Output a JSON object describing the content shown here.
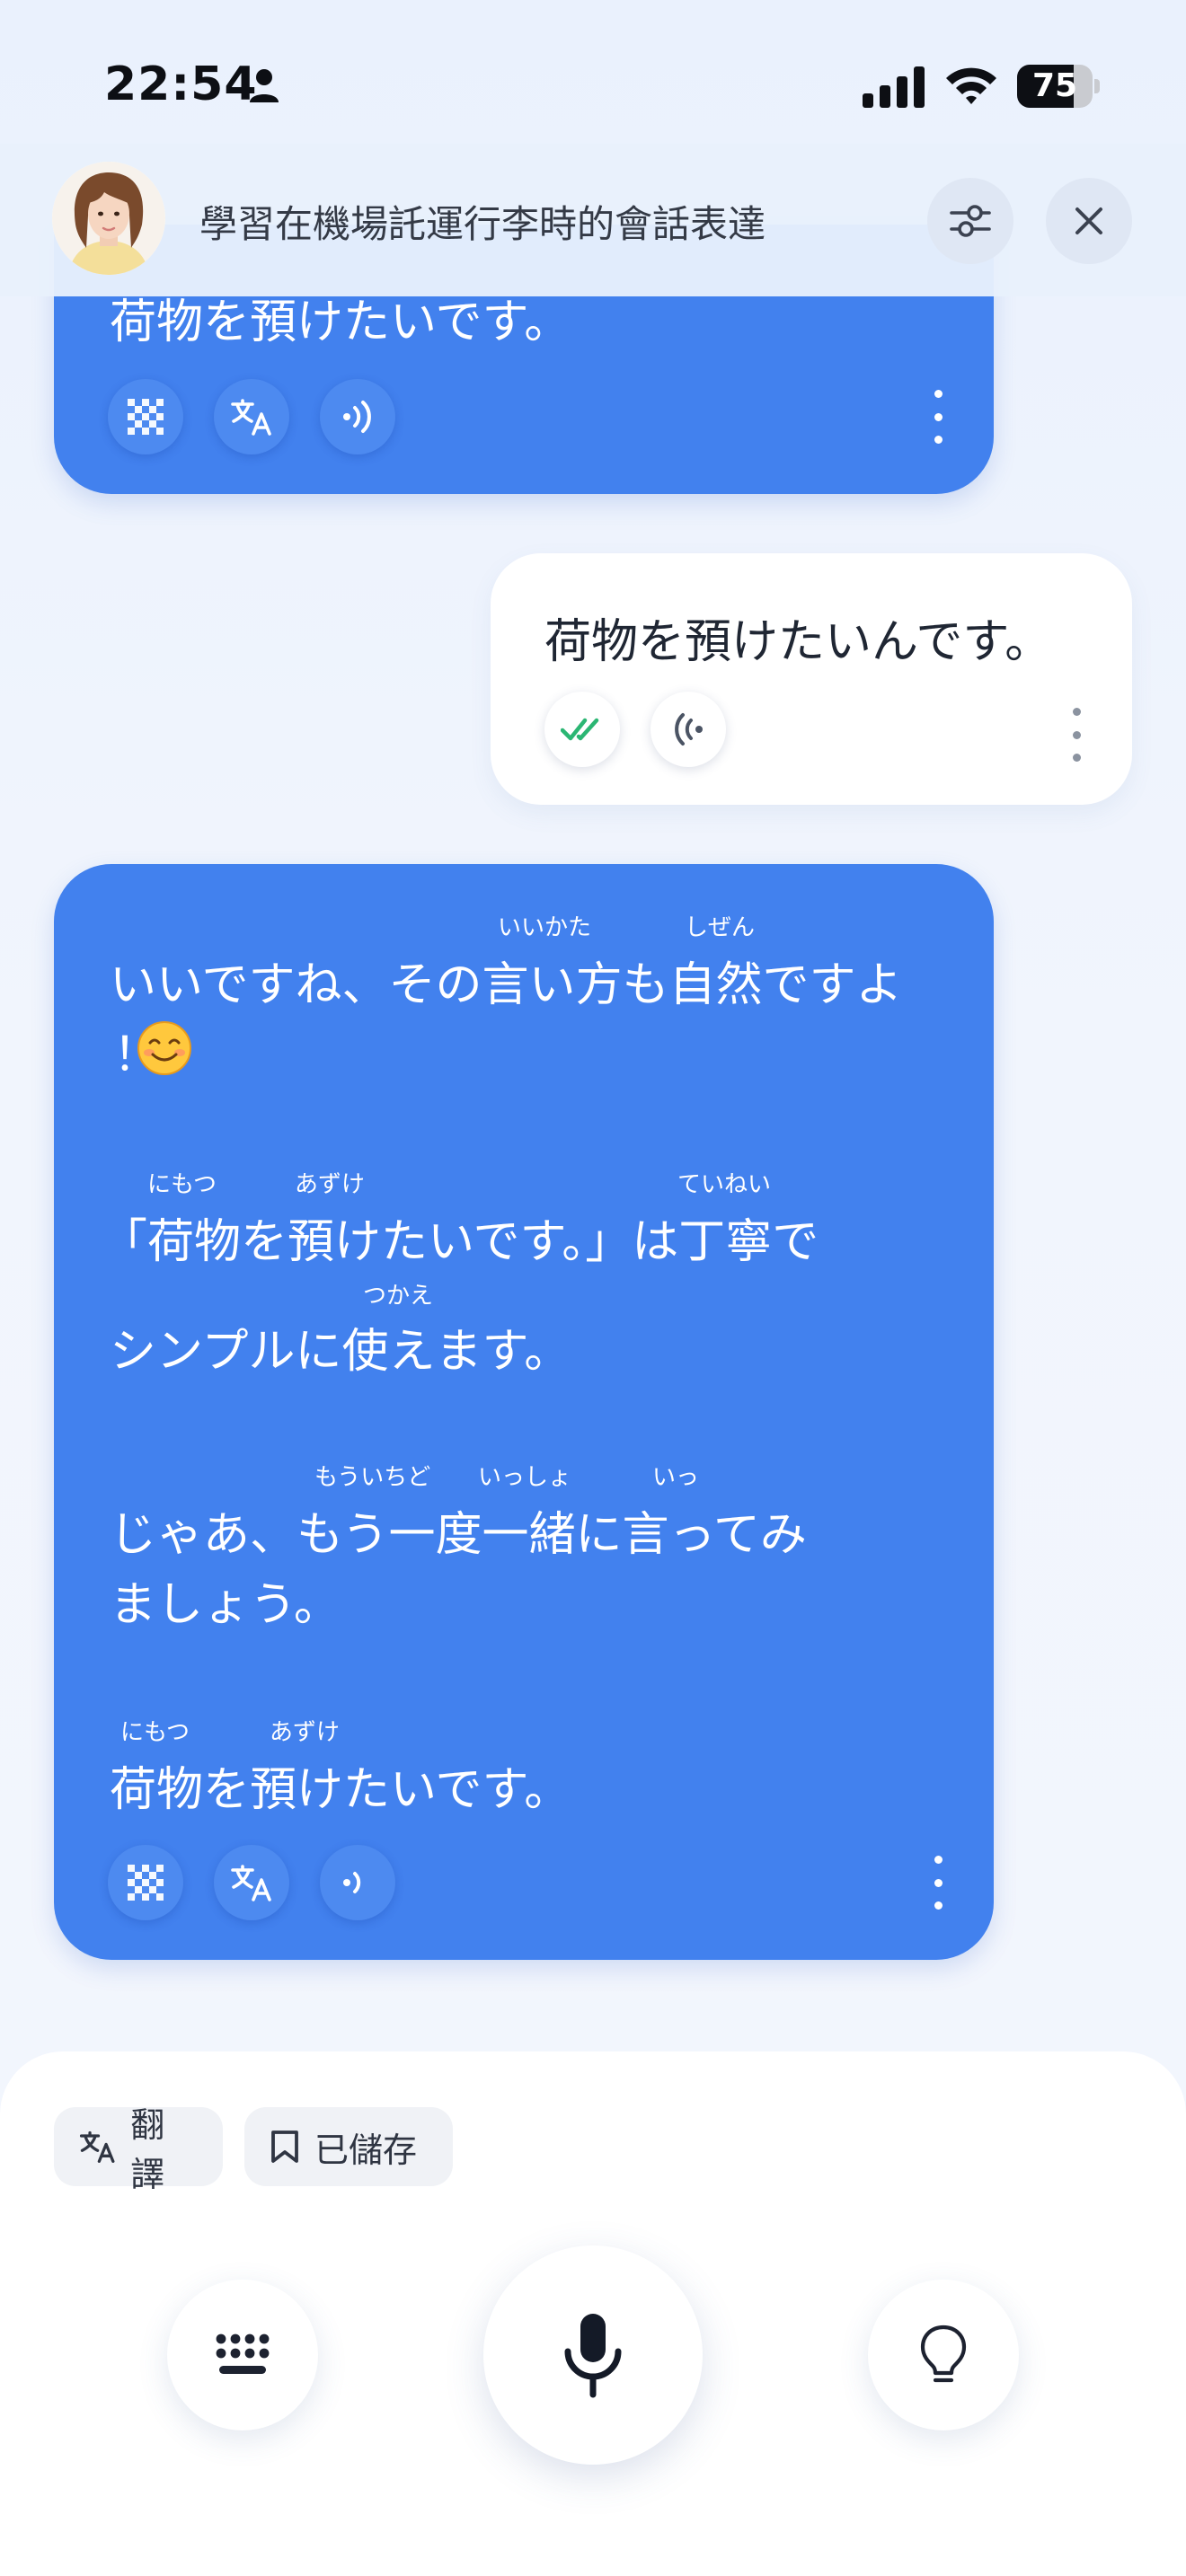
{
  "status_bar": {
    "time": "22:54",
    "battery_level": "75",
    "battery_fraction": 0.75
  },
  "header": {
    "title": "學習在機場託運行李時的會話表達",
    "settings_icon": "sliders-icon",
    "close_icon": "close-icon"
  },
  "messages": [
    {
      "role": "ai",
      "lines": [
        "荷物を預けたいです。"
      ]
    },
    {
      "role": "user",
      "text": "荷物を預けたいんです。",
      "status": "double-check-icon"
    },
    {
      "role": "ai",
      "lines": [
        "いいですね、その言い方も自然ですよ",
        "！",
        "「荷物を預けたいです。」は丁寧で",
        "シンプルに使えます。",
        "じゃあ、もう一度一緒に言ってみ",
        "ましょう。",
        "荷物を預けたいです。"
      ],
      "furigana": [
        "いいかた",
        "しぜん",
        "にもつ",
        "あずけ",
        "ていねい",
        "つかえ",
        "もういちど",
        "いっしょ",
        "いっ",
        "にもつ",
        "あずけ"
      ]
    }
  ],
  "bottom": {
    "translate_label": "翻譯",
    "saved_label": "已儲存"
  },
  "colors": {
    "ai_bubble": "#4281ee",
    "user_bubble": "#ffffff",
    "check_green": "#2bb673"
  }
}
